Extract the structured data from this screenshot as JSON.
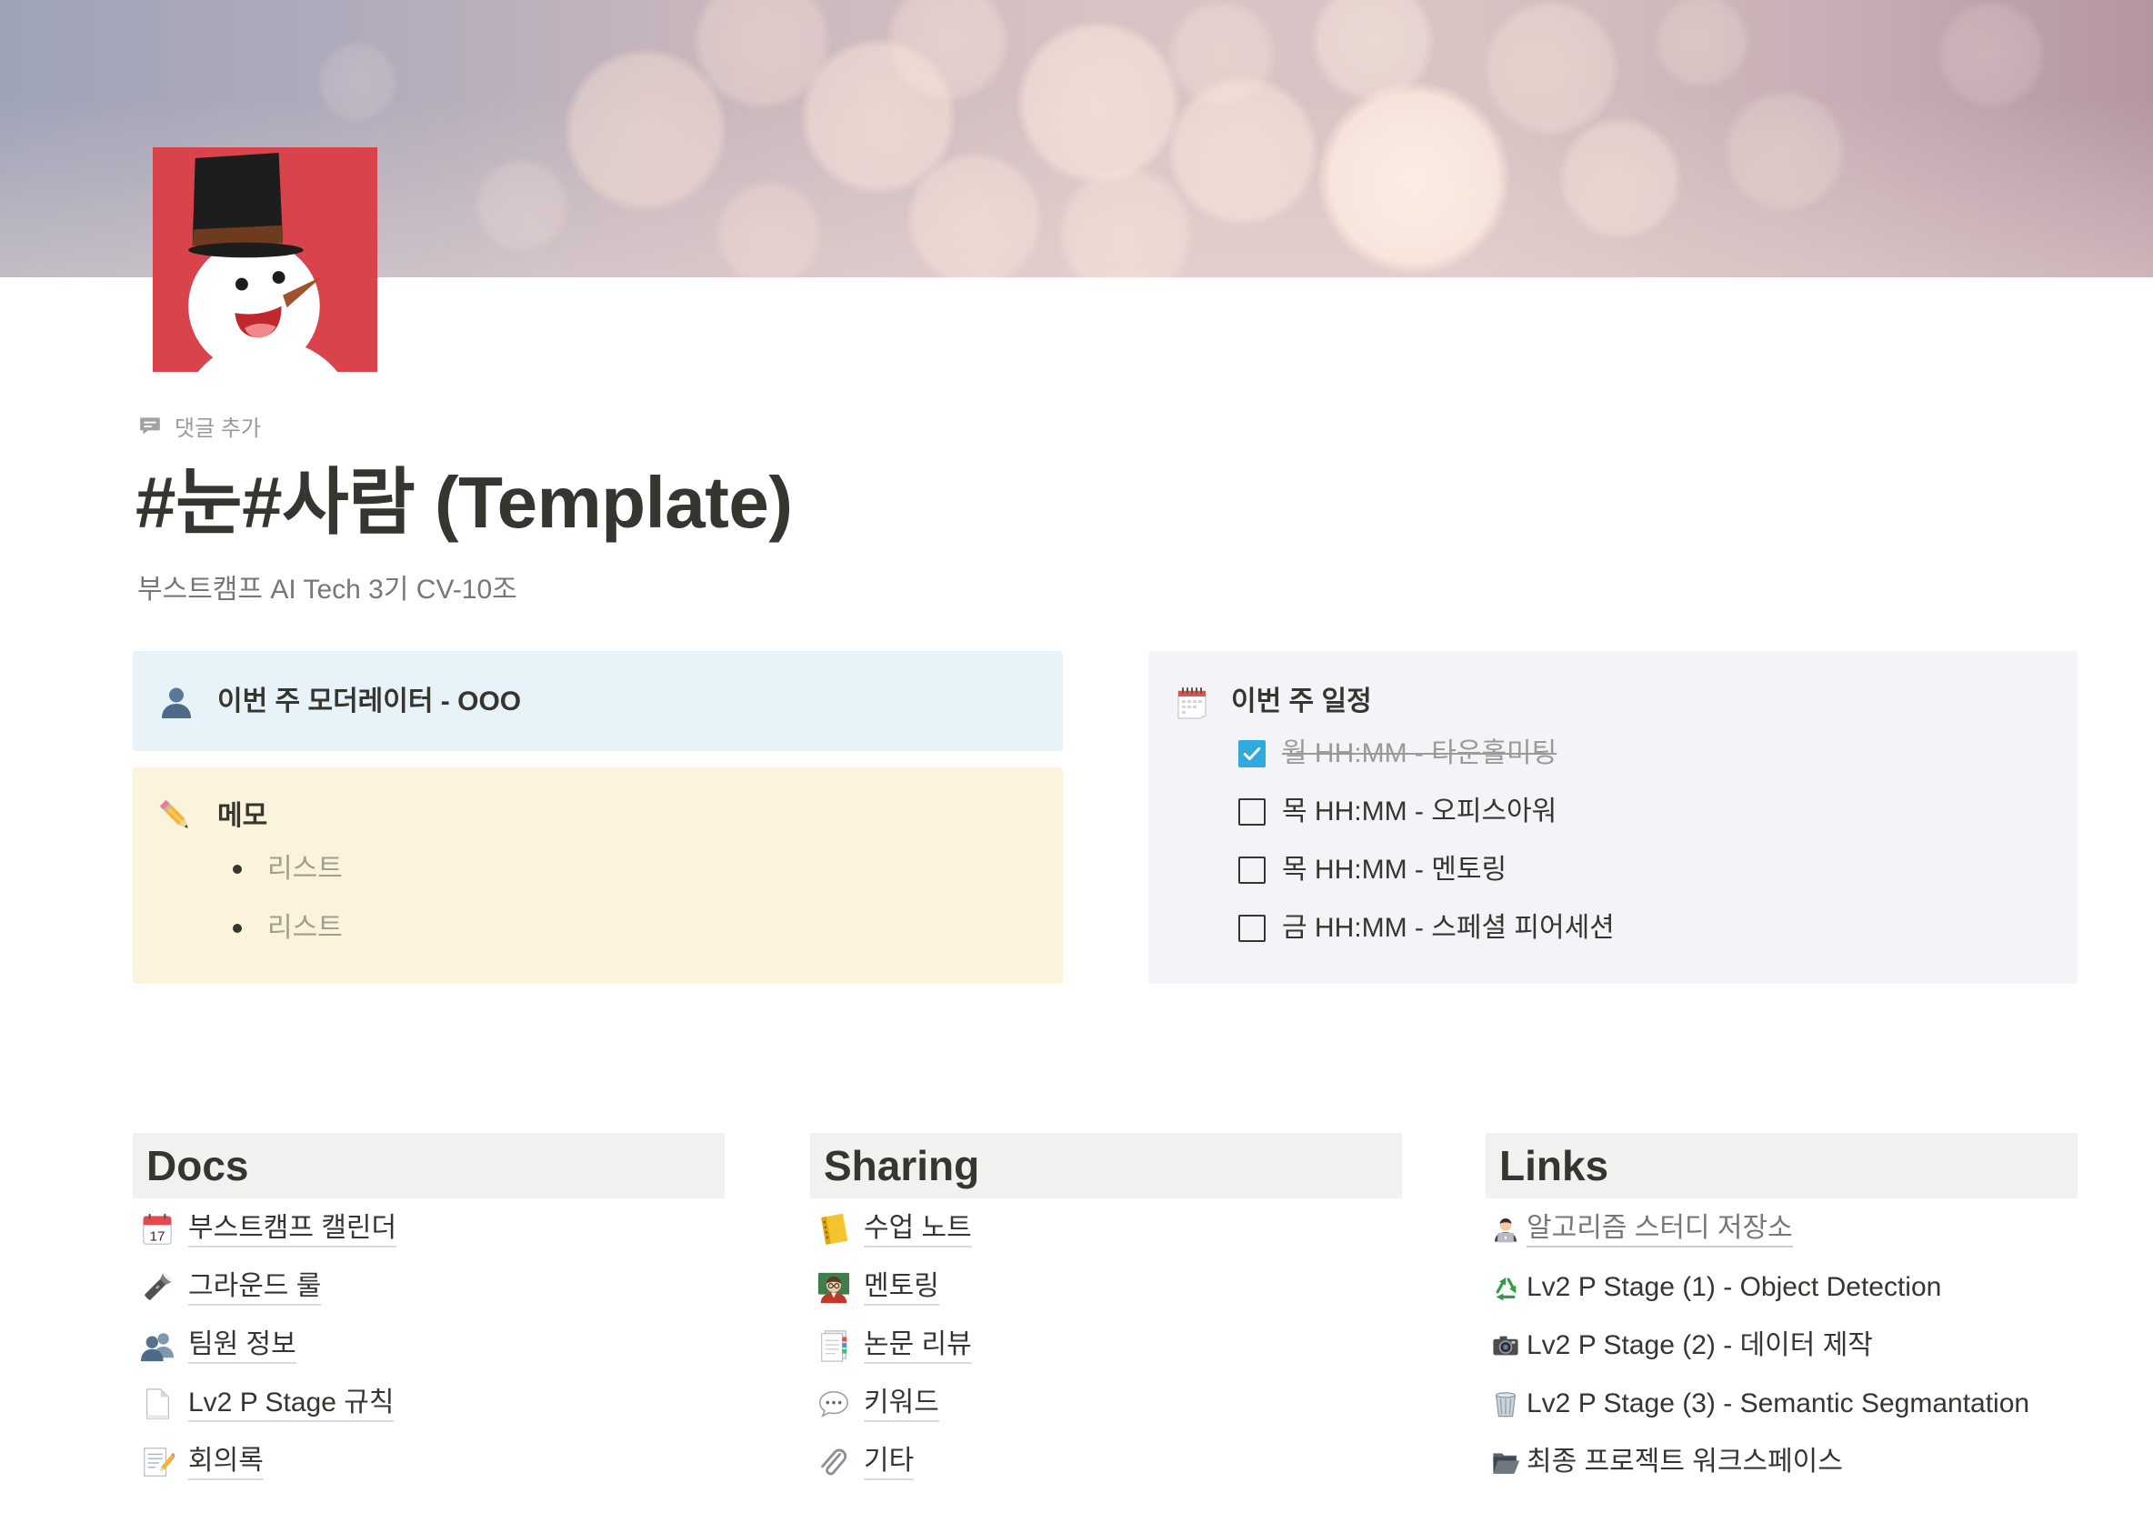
{
  "page": {
    "cover": "bokeh-lights-cover",
    "icon": "snowman-icon",
    "comment_icon": "comment-icon",
    "comment_label": "댓글 추가",
    "title": "#눈#사람 (Template)",
    "subtitle": "부스트캠프 AI Tech 3기 CV-10조"
  },
  "callouts": {
    "moderator": {
      "icon": "bust-in-silhouette-icon",
      "text": "이번 주 모더레이터 - OOO"
    },
    "memo": {
      "icon": "pencil-icon",
      "title": "메모",
      "items": [
        "리스트",
        "리스트"
      ]
    },
    "schedule": {
      "icon": "spiral-calendar-icon",
      "title": "이번 주 일정",
      "items": [
        {
          "text": "월 HH:MM - 타운홀미팅",
          "checked": true
        },
        {
          "text": "목 HH:MM - 오피스아워",
          "checked": false
        },
        {
          "text": "목 HH:MM - 멘토링",
          "checked": false
        },
        {
          "text": "금 HH:MM - 스페셜 피어세션",
          "checked": false
        }
      ]
    }
  },
  "sections": [
    {
      "heading": "Docs",
      "items": [
        {
          "icon": "calendar-icon",
          "icon_label": "17",
          "label": "부스트캠프 캘린더"
        },
        {
          "icon": "flashlight-icon",
          "label": "그라운드 룰"
        },
        {
          "icon": "busts-in-silhouette-icon",
          "label": "팀원 정보"
        },
        {
          "icon": "page-icon",
          "label": "Lv2 P Stage 규칙"
        },
        {
          "icon": "memo-icon",
          "label": "회의록"
        }
      ]
    },
    {
      "heading": "Sharing",
      "items": [
        {
          "icon": "ledger-icon",
          "label": "수업 노트"
        },
        {
          "icon": "teacher-icon",
          "label": "멘토링"
        },
        {
          "icon": "bookmark-tabs-icon",
          "label": "논문 리뷰"
        },
        {
          "icon": "speech-balloon-icon",
          "label": "키워드"
        },
        {
          "icon": "paperclip-icon",
          "label": "기타"
        }
      ]
    },
    {
      "heading": "Links",
      "items": [
        {
          "icon": "technologist-icon",
          "label": "알고리즘 스터디 저장소"
        },
        {
          "icon": "recycle-icon",
          "label": "Lv2 P Stage (1) - Object Detection"
        },
        {
          "icon": "camera-icon",
          "label": "Lv2 P Stage (2) - 데이터 제작"
        },
        {
          "icon": "wastebasket-icon",
          "label": "Lv2 P Stage (3) - Semantic Segmantation"
        },
        {
          "icon": "open-folder-icon",
          "label": "최종 프로젝트 워크스페이스"
        }
      ]
    }
  ],
  "theme": {
    "text": "#37352f",
    "muted": "#787774",
    "muted2": "#9b9a97",
    "memo_text": "#a29d8f",
    "accent": "#2eaadc",
    "bg_blue": "#e7f3f8",
    "bg_yellow": "#fbf3db",
    "bg_gray": "#f4f3f7",
    "bg_header": "#f1f1ef"
  }
}
